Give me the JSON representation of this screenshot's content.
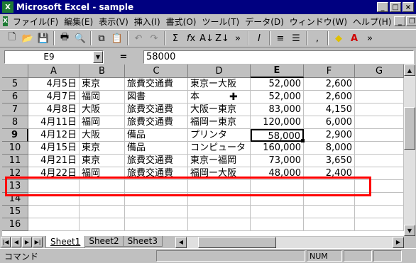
{
  "window": {
    "title": "Microsoft Excel - sample"
  },
  "menu": [
    "ファイル(F)",
    "編集(E)",
    "表示(V)",
    "挿入(I)",
    "書式(O)",
    "ツール(T)",
    "データ(D)",
    "ウィンドウ(W)",
    "ヘルプ(H)"
  ],
  "formula_bar": {
    "name_box": "E9",
    "equals": "=",
    "value": "58000"
  },
  "columns": [
    "A",
    "B",
    "C",
    "D",
    "E",
    "F",
    "G"
  ],
  "rows": [
    {
      "num": "5",
      "A": "4月5日",
      "B": "東京",
      "C": "旅費交通費",
      "D": "東京ー大阪",
      "E": "52,000",
      "F": "2,600"
    },
    {
      "num": "6",
      "A": "4月7日",
      "B": "福岡",
      "C": "図書",
      "D": "本",
      "E": "52,000",
      "F": "2,600"
    },
    {
      "num": "7",
      "A": "4月8日",
      "B": "大阪",
      "C": "旅費交通費",
      "D": "大阪ー東京",
      "E": "83,000",
      "F": "4,150"
    },
    {
      "num": "8",
      "A": "4月11日",
      "B": "福岡",
      "C": "旅費交通費",
      "D": "福岡ー東京",
      "E": "120,000",
      "F": "6,000"
    },
    {
      "num": "9",
      "A": "4月12日",
      "B": "大阪",
      "C": "備品",
      "D": "プリンタ",
      "E": "58,000",
      "F": "2,900"
    },
    {
      "num": "10",
      "A": "4月15日",
      "B": "東京",
      "C": "備品",
      "D": "コンピュータ",
      "E": "160,000",
      "F": "8,000"
    },
    {
      "num": "11",
      "A": "4月21日",
      "B": "東京",
      "C": "旅費交通費",
      "D": "東京ー福岡",
      "E": "73,000",
      "F": "3,650"
    },
    {
      "num": "12",
      "A": "4月22日",
      "B": "福岡",
      "C": "旅費交通費",
      "D": "福岡ー大阪",
      "E": "48,000",
      "F": "2,400"
    },
    {
      "num": "13",
      "A": "",
      "B": "",
      "C": "",
      "D": "",
      "E": "",
      "F": ""
    },
    {
      "num": "14",
      "A": "",
      "B": "",
      "C": "",
      "D": "",
      "E": "",
      "F": ""
    },
    {
      "num": "15",
      "A": "",
      "B": "",
      "C": "",
      "D": "",
      "E": "",
      "F": ""
    },
    {
      "num": "16",
      "A": "",
      "B": "",
      "C": "",
      "D": "",
      "E": "",
      "F": ""
    }
  ],
  "sheets": [
    "Sheet1",
    "Sheet2",
    "Sheet3"
  ],
  "status": {
    "mode": "コマンド",
    "num": "NUM"
  },
  "accent": {
    "titlebar": "#000080",
    "highlight": "#ff0000"
  }
}
